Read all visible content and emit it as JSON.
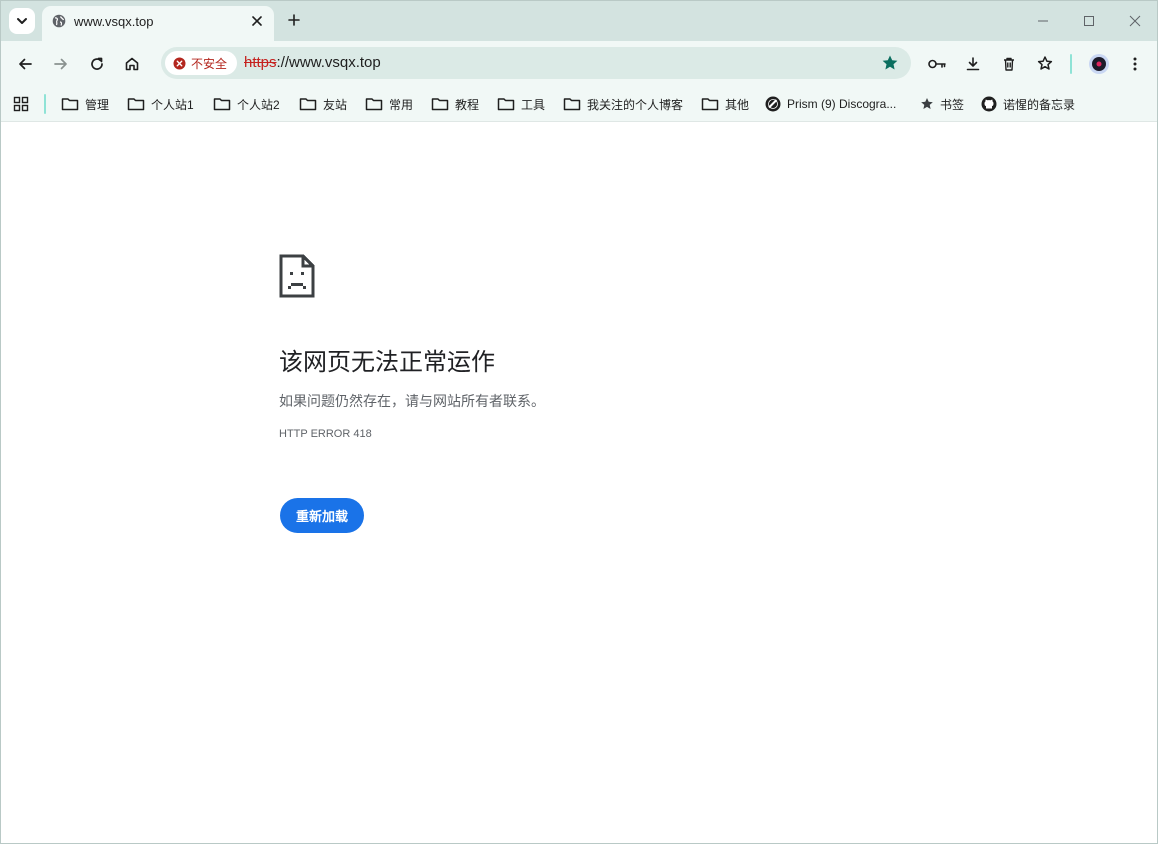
{
  "tab": {
    "title": "www.vsqx.top"
  },
  "omnibox": {
    "security_label": "不安全",
    "url_scheme": "https",
    "url_rest": "://www.vsqx.top"
  },
  "bookmarks": [
    {
      "label": "管理",
      "icon": "folder-icon"
    },
    {
      "label": "个人站1",
      "icon": "folder-icon"
    },
    {
      "label": "个人站2",
      "icon": "folder-icon"
    },
    {
      "label": "友站",
      "icon": "folder-icon"
    },
    {
      "label": "常用",
      "icon": "folder-icon"
    },
    {
      "label": "教程",
      "icon": "folder-icon"
    },
    {
      "label": "工具",
      "icon": "folder-icon"
    },
    {
      "label": "我关注的个人博客",
      "icon": "folder-icon"
    },
    {
      "label": "其他",
      "icon": "folder-icon"
    },
    {
      "label": "Prism (9) Discogra...",
      "icon": "discogs-icon"
    },
    {
      "label": "书签",
      "icon": "star-icon"
    },
    {
      "label": "诺惺的备忘录",
      "icon": "github-icon"
    }
  ],
  "error": {
    "title": "该网页无法正常运作",
    "description": "如果问题仍然存在，请与网站所有者联系。",
    "code": "HTTP ERROR 418",
    "reload_label": "重新加载"
  },
  "colors": {
    "accent": "#1a73e8",
    "frame": "#d3e3e0",
    "toolbar": "#f1f8f6",
    "bookmark_star": "#0b6e5f",
    "danger": "#b3261e"
  }
}
